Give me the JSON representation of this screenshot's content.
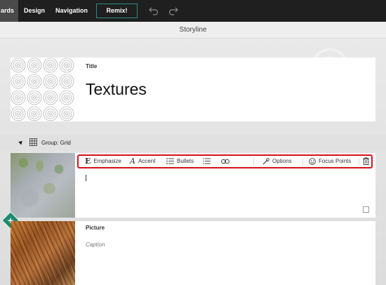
{
  "topbar": {
    "tabs": [
      {
        "label": "ards"
      },
      {
        "label": "Design"
      },
      {
        "label": "Navigation"
      }
    ],
    "remix_label": "Remix!",
    "accent": "#2f8a84"
  },
  "subheader": {
    "title": "Storyline"
  },
  "title_card": {
    "label": "Title",
    "text": "Textures"
  },
  "group": {
    "label": "Group: Grid"
  },
  "toolbar": {
    "emphasize": "Emphasize",
    "accent": "Accent",
    "bullets": "Bullets",
    "options": "Options",
    "focus_points": "Focus Points",
    "highlight_color": "#d0151c"
  },
  "picture_card": {
    "label": "Picture",
    "caption_placeholder": "Caption"
  },
  "add_button_color": "#1e8a6e"
}
